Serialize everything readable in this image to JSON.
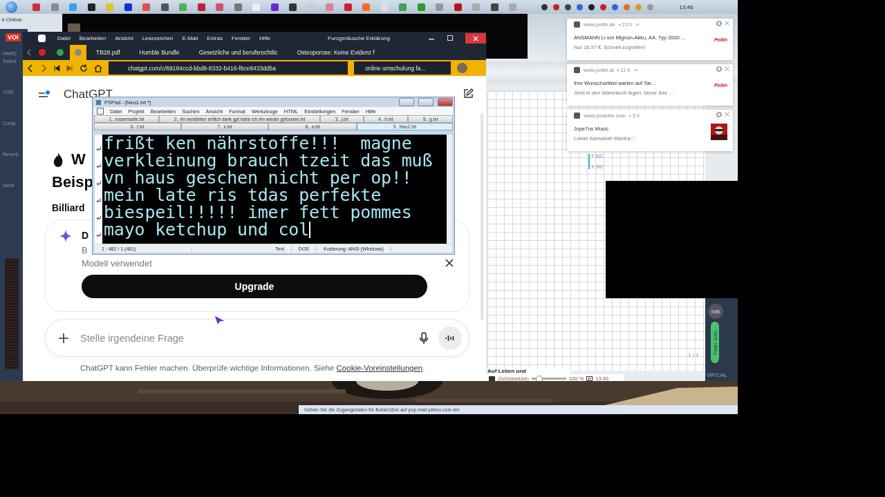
{
  "taskbar": {
    "clock": "13:46"
  },
  "side_panel": {
    "status": "4 Online",
    "channel": "VOI",
    "labels": [
      "HARD",
      "Select"
    ],
    "sections": [
      "VOIC",
      "Comp",
      "Reverb",
      "Send"
    ]
  },
  "browser": {
    "menu": [
      "Datei",
      "Bearbeiten",
      "Ansicht",
      "Lesezeichen",
      "E-Mail",
      "Extras",
      "Fenster",
      "Hilfe"
    ],
    "title": "Furzgeräusche Erklärung",
    "tabs": [
      {
        "kind": "video-pin",
        "selected": false
      },
      {
        "kind": "app-pin",
        "selected": false
      },
      {
        "kind": "chat-pin",
        "selected": true
      },
      {
        "kind": "page",
        "label": "TB28.pdf",
        "selected": false
      },
      {
        "kind": "page",
        "label": "Humble Bundle",
        "selected": false
      },
      {
        "kind": "page",
        "label": "Gesetzliche und berufsrechtlic",
        "selected": false
      },
      {
        "kind": "page",
        "label": "Osteoporose: Keine Evidenz f",
        "selected": false
      }
    ],
    "url": "chatgpt.com/c/69184ccd-bbd8-8332-b416-f6ce8433dd5a",
    "search": "online umschulung fa..."
  },
  "page": {
    "brand": "ChatGPT",
    "heading": [
      "W",
      "Beisp"
    ],
    "subheading": "Billiard",
    "card": {
      "title": "D",
      "lines": [
        "B",
        "Modell verwendet"
      ],
      "button": "Upgrade"
    },
    "composer": {
      "placeholder": "Stelle irgendeine Frage"
    },
    "footer": {
      "text": "ChatGPT kann Fehler machen. Überprüfe wichtige Informationen. Siehe ",
      "link": "Cookie-Voreinstellungen",
      "end": "."
    }
  },
  "pspad": {
    "title": "PSPad - [Neu1.txt *]",
    "menu": [
      "Datei",
      "Projekt",
      "Bearbeiten",
      "Suchen",
      "Ansicht",
      "Format",
      "Werkzeuge",
      "HTML",
      "Einstellungen",
      "Fenster",
      "Hilfe"
    ],
    "tab_rows": [
      [
        {
          "label": "1.. russenseite.txt",
          "selected": false
        },
        {
          "label": "2.. kh verstärker entlich dank gpt habe ich ihn wieder gefunden.txt",
          "selected": false
        },
        {
          "label": "3.. j.txt",
          "selected": false
        },
        {
          "label": "4.. h.txt",
          "selected": false
        },
        {
          "label": "5.. g.txt",
          "selected": false
        }
      ],
      [
        {
          "label": "6.. f.txt",
          "selected": false
        },
        {
          "label": "7.. s.txt",
          "selected": false
        },
        {
          "label": "8.. a.txt",
          "selected": false
        },
        {
          "label": "9.. Neu1.txt",
          "selected": true
        }
      ]
    ],
    "lines": [
      "frißt ken nährstoffe!!!  magne",
      "verkleinung brauch tzeit das muß",
      "vn haus geschen nicht per op!!",
      "mein late ris tdas perfekte",
      "biespeil!!!!! imer fett pommes",
      "mayo ketchup und col"
    ],
    "status": [
      "1 : 482 / 1  (481)",
      "Text",
      "DOS",
      "Kodierung: ANSI (Windows)"
    ]
  },
  "notifications": [
    {
      "site": "www.pollin.de",
      "age": "• 23 h",
      "expandable": true,
      "title": "ANSMANN Li-Ion Mignon-Akku, AA, Typ 2000 ...",
      "body": "Nur 16.97 €. Schnell zugreifen!",
      "kind": "logo",
      "logo": "Pollin"
    },
    {
      "site": "www.pollin.at",
      "age": "• 11 h",
      "expandable": true,
      "title": "Ihre Wunschartikel warten auf Sie...",
      "body": "Jetzt in den Warenkorb legen, bevor Ihre ...",
      "kind": "logo",
      "logo": "Pollin"
    },
    {
      "site": "www.youtube.com",
      "age": "• 3 h",
      "expandable": false,
      "title": "Jupe7us Music",
      "body": "Lokah Samastah Mantra □",
      "kind": "picture"
    }
  ],
  "daw": {
    "tracks": [
      "T SIC",
      "Y SIC"
    ],
    "doc_text": "Auf Leben und",
    "page": "1 / 1",
    "db": "0dB",
    "fader": "Fader Gain",
    "virtual": "VIRTUAL",
    "reset": "Zurücksetzen",
    "zoom_slider": {
      "level": 0.2
    },
    "zoom": "100 %",
    "clock": "13:46"
  },
  "mail_prompt": "Geben Sie die Zugangsdaten für florian16xx auf pop.mail.yahoo.com ein"
}
